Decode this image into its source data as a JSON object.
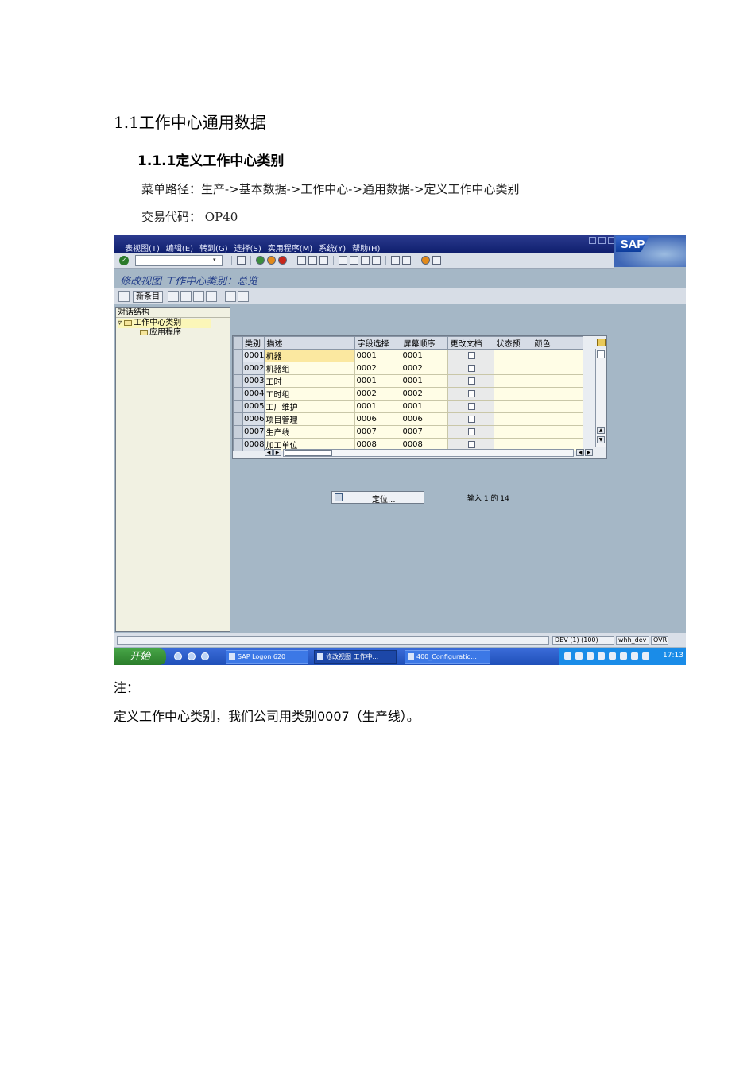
{
  "doc": {
    "heading": "1.1工作中心通用数据",
    "subheading": "1.1.1定义工作中心类别",
    "menu_path": "菜单路径：生产->基本数据->工作中心->通用数据->定义工作中心类别",
    "tcode": "交易代码： OP40",
    "note_label": "注：",
    "note_text": "定义工作中心类别，我们公司用类别0007（生产线）。"
  },
  "sap": {
    "menu": [
      "表视图(T)",
      "编辑(E)",
      "转到(G)",
      "选择(S)",
      "实用程序(M)",
      "系统(Y)",
      "帮助(H)"
    ],
    "logo": "SAP",
    "screen_title": "修改视图 工作中心类别：总览",
    "new_entry_label": "新条目",
    "tree": {
      "header": "对话结构",
      "node1": "工作中心类别",
      "node2": "应用程序"
    },
    "grid": {
      "columns": [
        "类别",
        "描述",
        "字段选择",
        "屏幕顺序",
        "更改文档",
        "状态预",
        "颜色"
      ],
      "rows": [
        {
          "cat": "0001",
          "desc": "机器",
          "field": "0001",
          "screen": "0001"
        },
        {
          "cat": "0002",
          "desc": "机器组",
          "field": "0002",
          "screen": "0002"
        },
        {
          "cat": "0003",
          "desc": "工时",
          "field": "0001",
          "screen": "0001"
        },
        {
          "cat": "0004",
          "desc": "工时组",
          "field": "0002",
          "screen": "0002"
        },
        {
          "cat": "0005",
          "desc": "工厂维护",
          "field": "0001",
          "screen": "0001"
        },
        {
          "cat": "0006",
          "desc": "项目管理",
          "field": "0006",
          "screen": "0006"
        },
        {
          "cat": "0007",
          "desc": "生产线",
          "field": "0007",
          "screen": "0007"
        },
        {
          "cat": "0008",
          "desc": "加工单位",
          "field": "0008",
          "screen": "0008"
        }
      ]
    },
    "position_button": "定位...",
    "entry_info": "输入 1 的 14",
    "status": {
      "system": "DEV (1) (100)",
      "user": "whh_dev",
      "mode": "OVR"
    },
    "taskbar": {
      "start": "开始",
      "items": [
        "SAP Logon 620",
        "修改视图 工作中...",
        "400_Configuratio..."
      ],
      "clock": "17:13"
    }
  }
}
